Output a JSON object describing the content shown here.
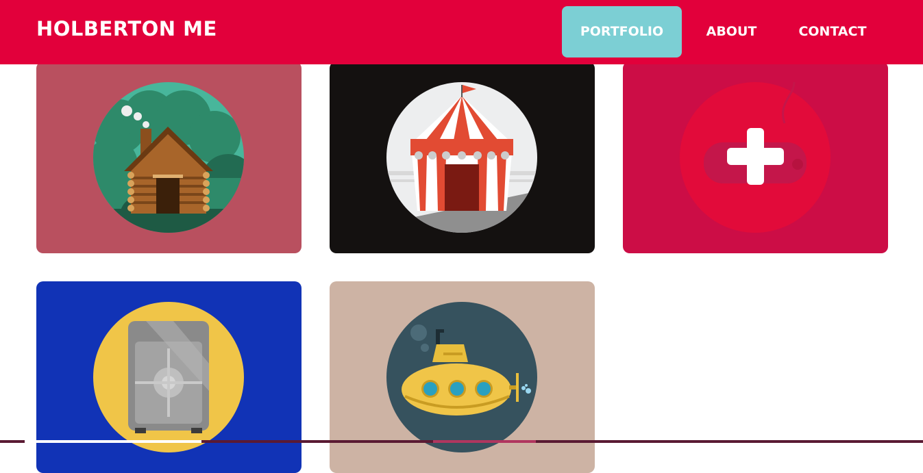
{
  "header": {
    "brand": "HOLBERTON ME",
    "nav": [
      {
        "label": "PORTFOLIO",
        "active": true
      },
      {
        "label": "ABOUT",
        "active": false
      },
      {
        "label": "CONTACT",
        "active": false
      }
    ]
  },
  "colors": {
    "header_bg": "#e2003b",
    "nav_active_bg": "#7ccfd4",
    "text": "#ffffff"
  },
  "portfolio": {
    "items": [
      {
        "icon": "log-cabin-icon",
        "bg": "#b9505f"
      },
      {
        "icon": "circus-tent-icon",
        "bg": "#141110"
      },
      {
        "icon": "game-controller-icon",
        "bg": "#cc0d46",
        "hover_overlay": "plus-icon"
      },
      {
        "icon": "safe-vault-icon",
        "bg": "#1133b6"
      },
      {
        "icon": "submarine-icon",
        "bg": "#cdb3a4"
      }
    ]
  }
}
